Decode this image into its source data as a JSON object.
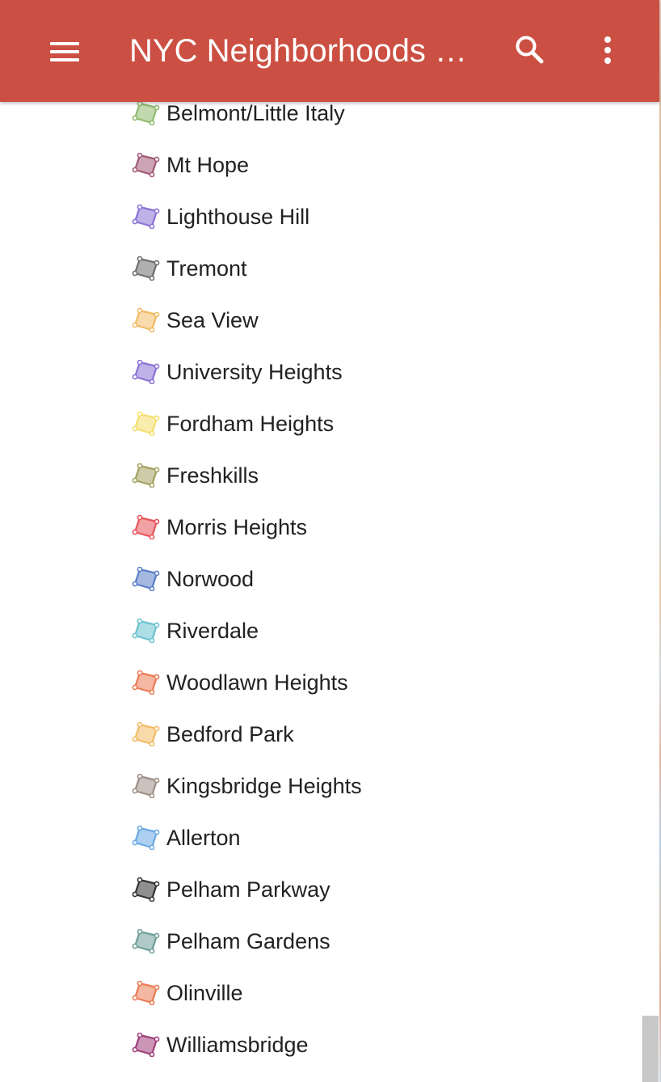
{
  "header": {
    "title": "NYC Neighborhoods M...",
    "background_color": "#cb4f42",
    "menu_icon": "hamburger-menu-icon",
    "search_icon": "search-icon",
    "more_icon": "more-vertical-icon"
  },
  "neighborhoods": [
    {
      "name": "Belmont/Little Italy",
      "color": "#8fba6e"
    },
    {
      "name": "Mt Hope",
      "color": "#a35a77"
    },
    {
      "name": "Lighthouse Hill",
      "color": "#8a73d6"
    },
    {
      "name": "Tremont",
      "color": "#6e6e6e"
    },
    {
      "name": "Sea View",
      "color": "#f2bb66"
    },
    {
      "name": "University Heights",
      "color": "#8a73d6"
    },
    {
      "name": "Fordham Heights",
      "color": "#f4df6c"
    },
    {
      "name": "Freshkills",
      "color": "#a3a160"
    },
    {
      "name": "Morris Heights",
      "color": "#e8545a"
    },
    {
      "name": "Norwood",
      "color": "#5b7fc6"
    },
    {
      "name": "Riverdale",
      "color": "#6cc2cf"
    },
    {
      "name": "Woodlawn Heights",
      "color": "#ea7b55"
    },
    {
      "name": "Bedford Park",
      "color": "#f2bb66"
    },
    {
      "name": "Kingsbridge Heights",
      "color": "#a08f86"
    },
    {
      "name": "Allerton",
      "color": "#6aa9e4"
    },
    {
      "name": "Pelham Parkway",
      "color": "#333333"
    },
    {
      "name": "Pelham Gardens",
      "color": "#6e9e99"
    },
    {
      "name": "Olinville",
      "color": "#ea7b55"
    },
    {
      "name": "Williamsbridge",
      "color": "#a0407a"
    }
  ]
}
